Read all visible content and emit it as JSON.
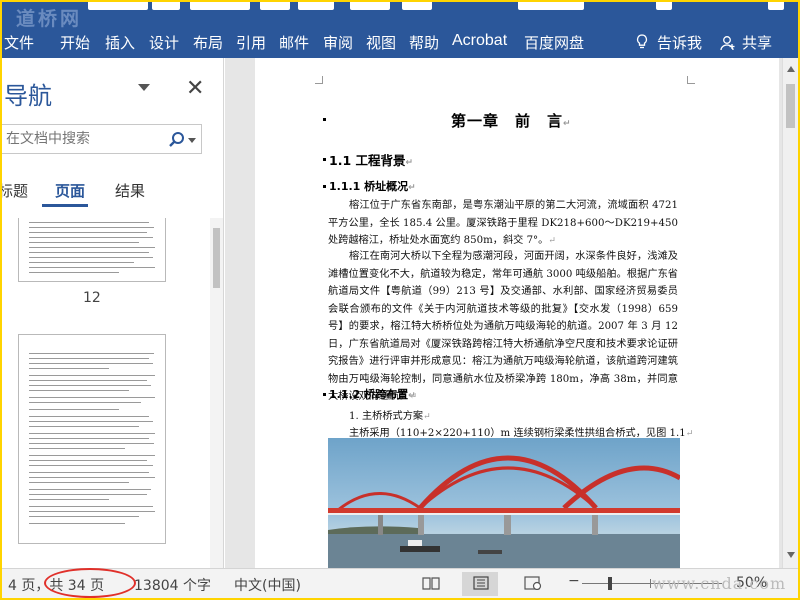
{
  "watermarks": {
    "top_left": "道桥网",
    "bottom_right": "www.cnda.com"
  },
  "ribbon": {
    "tabs": [
      "文件",
      "开始",
      "插入",
      "设计",
      "布局",
      "引用",
      "邮件",
      "审阅",
      "视图",
      "帮助",
      "Acrobat",
      "百度网盘"
    ],
    "tell_me": "告诉我",
    "share": "共享",
    "color": "#2b579a"
  },
  "nav_pane": {
    "title": "导航",
    "search_placeholder": "在文档中搜索",
    "tabs": [
      "标题",
      "页面",
      "结果"
    ],
    "active_tab": "页面",
    "thumbnail_page_number": "12"
  },
  "document": {
    "chapter_title": "第一章　前　言",
    "section_1_1": "1.1 工程背景",
    "section_1_1_1": "1.1.1 桥址概况",
    "para_1": "榕江位于广东省东南部，是粤东潮汕平原的第二大河流，流域面积 4721 平方公里，全长 185.4 公里。厦深铁路于里程 DK218+600～DK219+450 处跨越榕江，桥址处水面宽约 850m，斜交 7°。",
    "para_2": "榕江在南河大桥以下全程为感潮河段，河面开阔，水深条件良好，浅滩及滩槽位置变化不大，航道较为稳定，常年可通航 3000 吨级船舶。根据广东省航道局文件【粤航道（99）213 号】及交通部、水利部、国家经济贸易委员会联合颁布的文件《关于内河航道技术等级的批复》【交水发（1998）659 号】的要求，榕江特大桥桥位处为通航万吨级海轮的航道。2007 年 3 月 12 日，广东省航道局对《厦深铁路跨榕江特大桥通航净空尺度和技术要求论证研究报告》进行评审并形成意见：榕江为通航万吨级海轮航道，该航道跨河建筑物由万吨级海轮控制，同意通航水位及桥梁净跨 180m，净高 38m，并同意大桥设双向通航。",
    "section_1_1_2": "1.1.2 桥跨布置",
    "list_item_1": "1. 主桥桥式方案",
    "body_line": "主桥采用（110+2×220+110）m 连续钢桁梁柔性拱组合桥式，见图 1.1"
  },
  "status_bar": {
    "page_pos": "4 页，共 34 页",
    "word_count": "13804 个字",
    "language": "中文(中国)",
    "zoom": "50%"
  },
  "annotation_color": "#e0302a"
}
